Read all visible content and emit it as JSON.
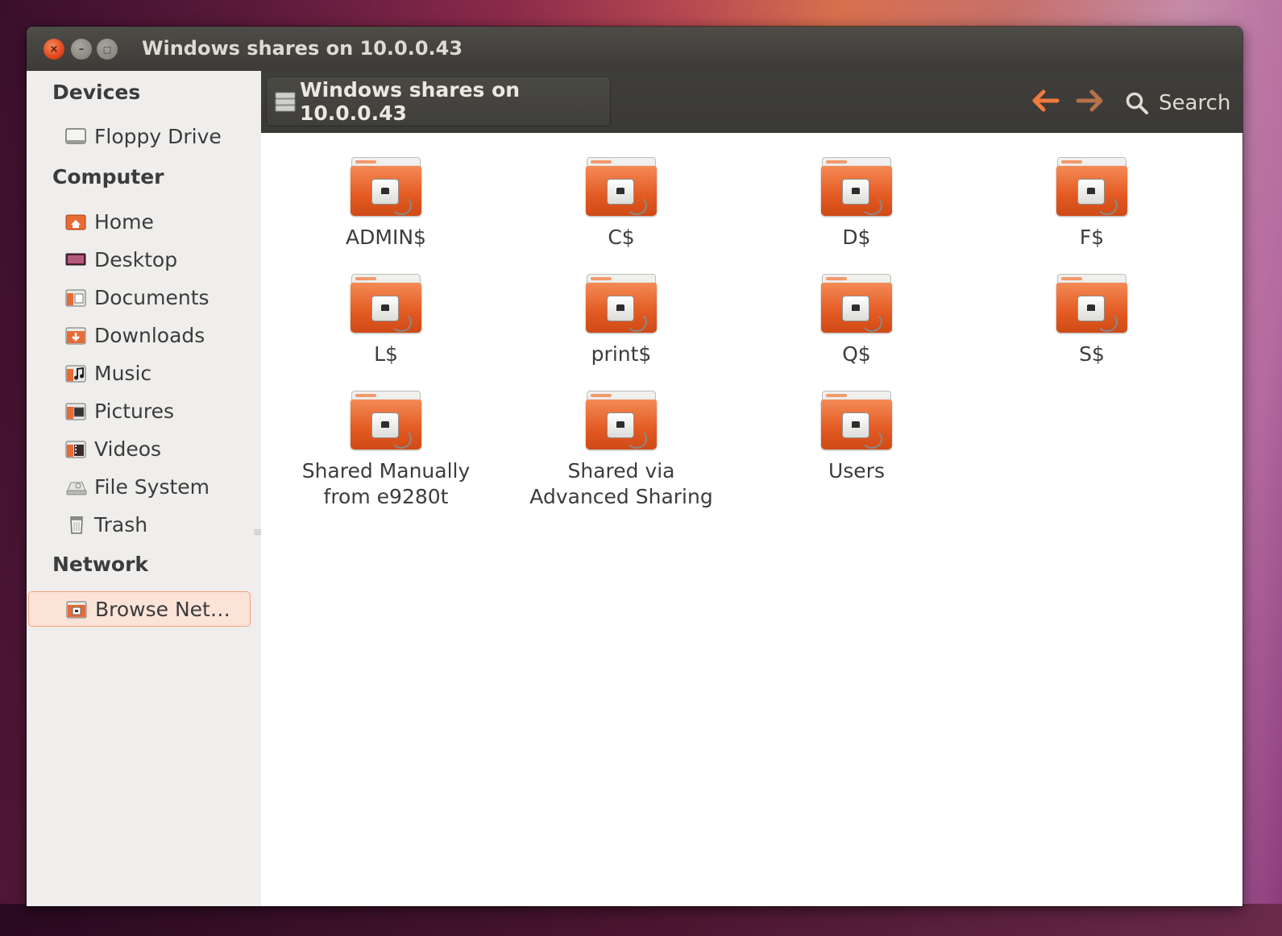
{
  "window": {
    "title": "Windows shares on 10.0.0.43"
  },
  "titlebar_buttons": {
    "close": "×",
    "minimize": "–",
    "maximize": "□"
  },
  "sidebar": {
    "sections": [
      {
        "heading": "Devices",
        "items": [
          {
            "label": "Floppy Drive",
            "icon": "floppy-icon"
          }
        ]
      },
      {
        "heading": "Computer",
        "items": [
          {
            "label": "Home",
            "icon": "home-folder-icon"
          },
          {
            "label": "Desktop",
            "icon": "desktop-icon"
          },
          {
            "label": "Documents",
            "icon": "documents-folder-icon"
          },
          {
            "label": "Downloads",
            "icon": "downloads-folder-icon"
          },
          {
            "label": "Music",
            "icon": "music-folder-icon"
          },
          {
            "label": "Pictures",
            "icon": "pictures-folder-icon"
          },
          {
            "label": "Videos",
            "icon": "videos-folder-icon"
          },
          {
            "label": "File System",
            "icon": "harddisk-icon"
          },
          {
            "label": "Trash",
            "icon": "trash-icon"
          }
        ]
      },
      {
        "heading": "Network",
        "items": [
          {
            "label": "Browse Net…",
            "icon": "network-folder-icon",
            "selected": true
          }
        ]
      }
    ]
  },
  "toolbar": {
    "breadcrumb": "Windows shares on 10.0.0.43",
    "back_arrow": "🡐",
    "forward_arrow": "🡒",
    "search_label": "Search"
  },
  "shares": [
    {
      "name": "ADMIN$"
    },
    {
      "name": "C$"
    },
    {
      "name": "D$"
    },
    {
      "name": "F$"
    },
    {
      "name": "L$"
    },
    {
      "name": "print$"
    },
    {
      "name": "Q$"
    },
    {
      "name": "S$"
    },
    {
      "name": "Shared Manually from e9280t"
    },
    {
      "name": "Shared via Advanced Sharing"
    },
    {
      "name": "Users"
    }
  ],
  "colors": {
    "accent": "#e35a22",
    "selection_bg": "#fbe3d8",
    "titlebar": "#3c3b37"
  }
}
